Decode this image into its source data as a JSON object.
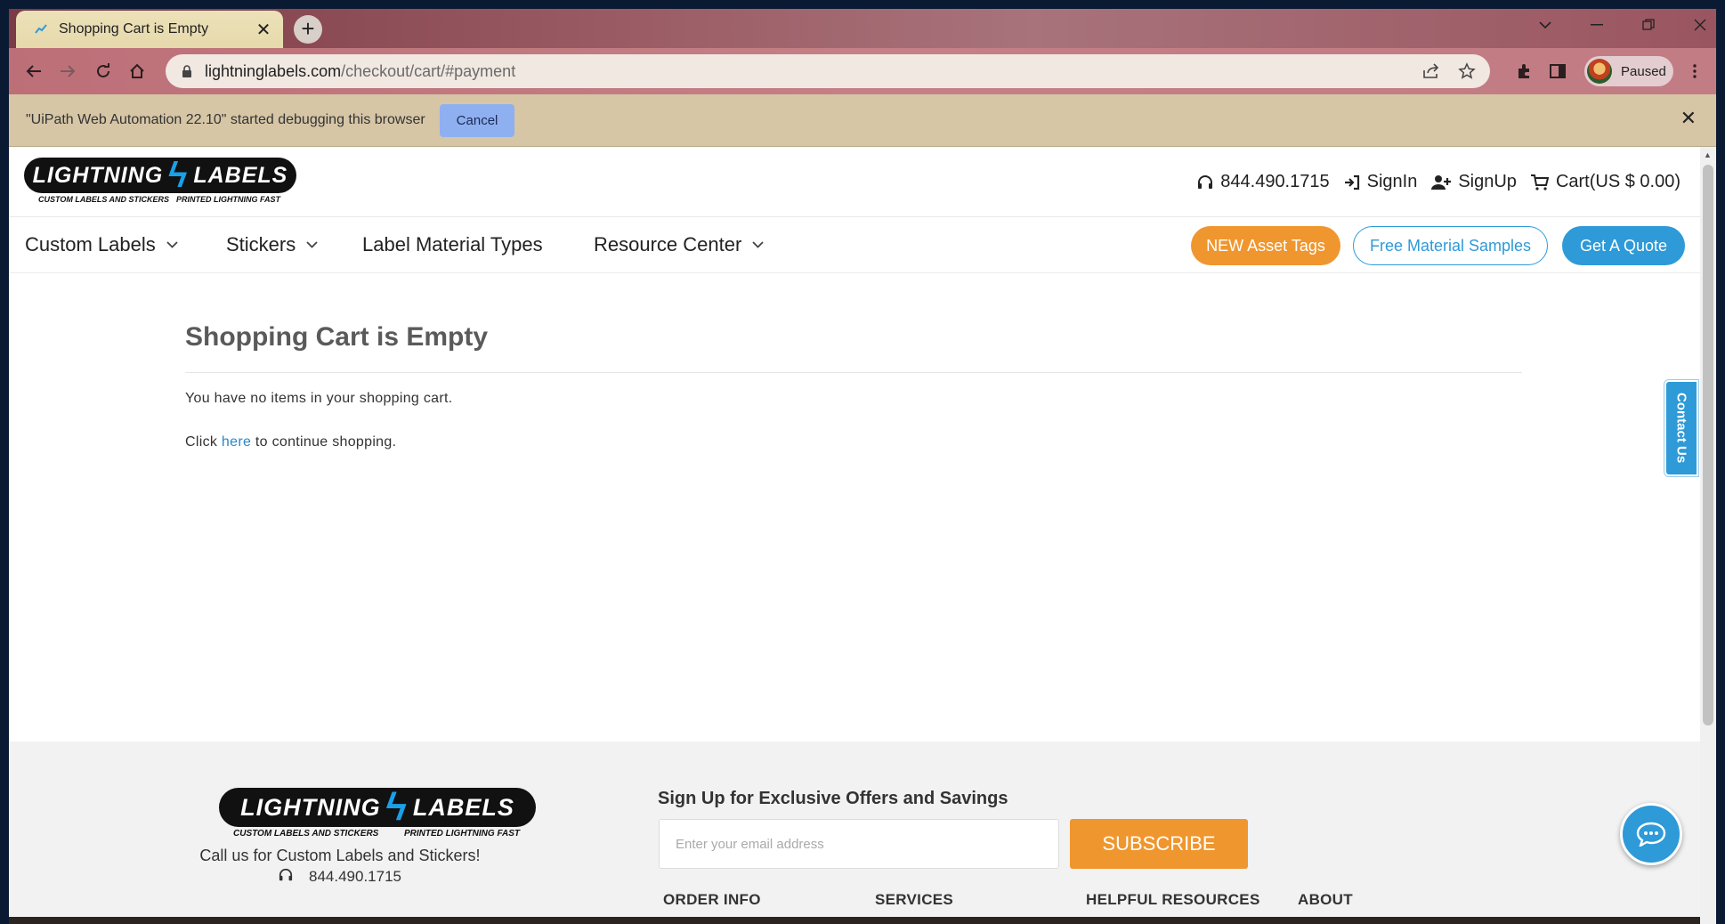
{
  "browser": {
    "tab_title": "Shopping Cart is Empty",
    "url_host": "lightninglabels.com",
    "url_path": "/checkout/cart/#payment",
    "profile_status": "Paused",
    "new_tab_symbol": "+",
    "tab_close_symbol": "✕"
  },
  "infobar": {
    "message": "\"UiPath Web Automation 22.10\" started debugging this browser",
    "cancel_label": "Cancel",
    "close_symbol": "✕"
  },
  "header": {
    "logo_word1": "LIGHTNING",
    "logo_word2": "LABELS",
    "logo_tag_left": "CUSTOM LABELS AND STICKERS",
    "logo_tag_right": "PRINTED LIGHTNING FAST",
    "phone": "844.490.1715",
    "signin": "SignIn",
    "signup": "SignUp",
    "cart": "Cart(US $ 0.00)"
  },
  "nav": {
    "items": [
      {
        "label": "Custom Labels"
      },
      {
        "label": "Stickers"
      },
      {
        "label": "Label Material Types"
      },
      {
        "label": "Resource Center"
      }
    ],
    "asset_tags": "NEW Asset Tags",
    "free_samples": "Free Material Samples",
    "quote": "Get A Quote"
  },
  "content": {
    "title": "Shopping Cart is Empty",
    "line1": "You have no items in your shopping cart.",
    "line2_prefix": "Click ",
    "line2_link": "here",
    "line2_suffix": " to continue shopping."
  },
  "contact_tab": "Contact Us",
  "footer": {
    "call_text": "Call us for Custom Labels and Stickers!",
    "phone": "844.490.1715",
    "signup_title": "Sign Up for Exclusive Offers and Savings",
    "email_placeholder": "Enter your email address",
    "subscribe": "SUBSCRIBE",
    "columns": [
      "ORDER INFO",
      "SERVICES",
      "HELPFUL RESOURCES",
      "ABOUT"
    ]
  },
  "colors": {
    "accent_blue": "#2e9ad8",
    "accent_orange": "#f0962e"
  }
}
